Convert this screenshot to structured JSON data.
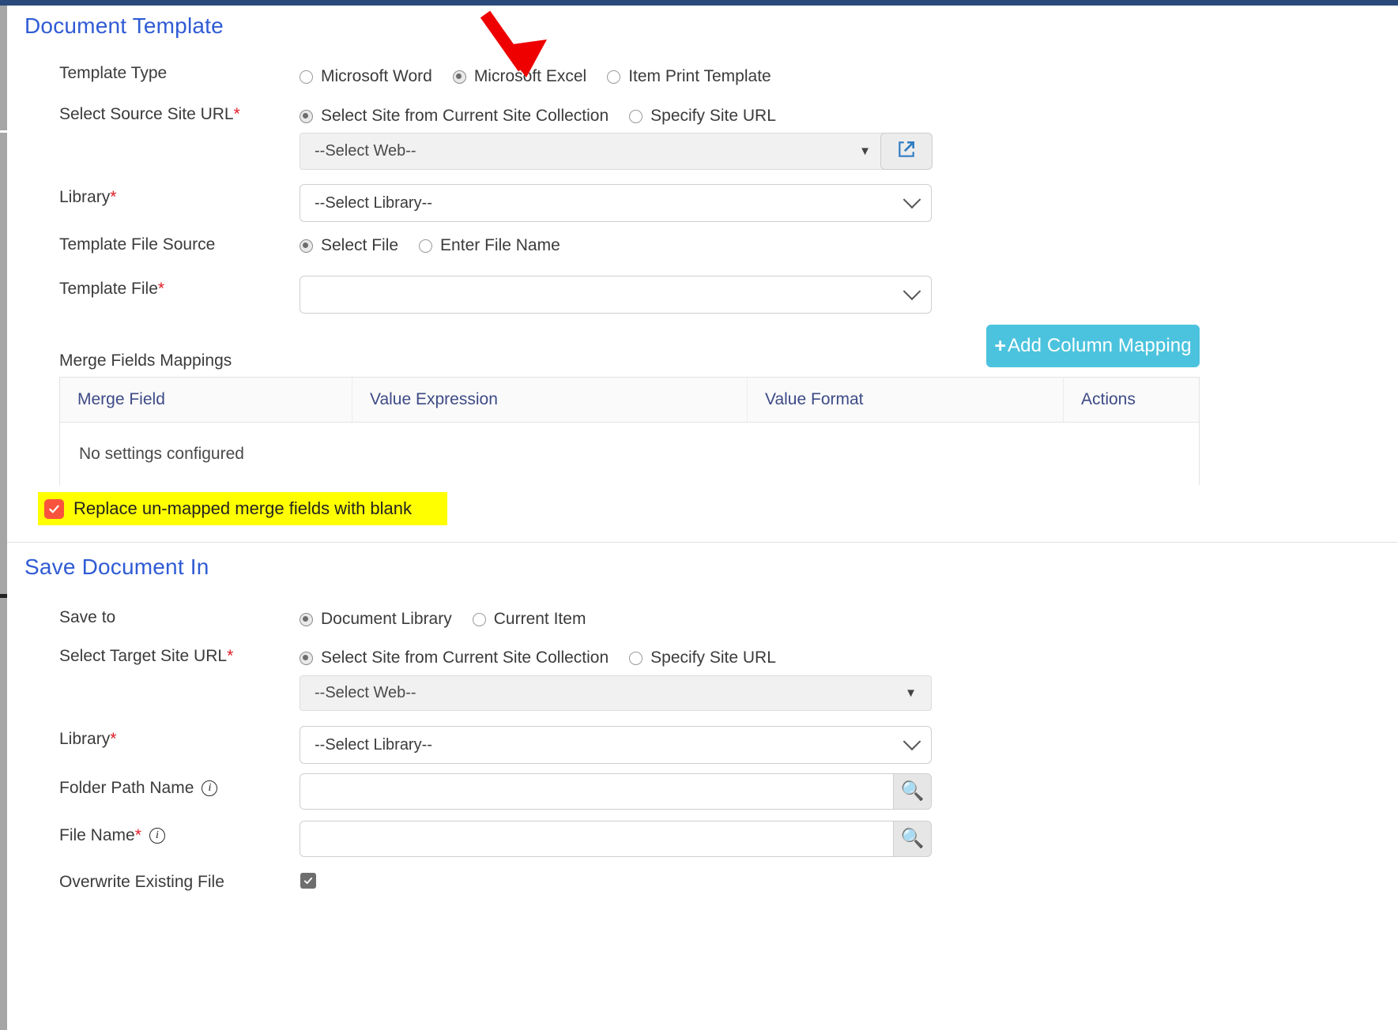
{
  "document_template": {
    "heading": "Document Template",
    "template_type": {
      "label": "Template Type",
      "options": [
        "Microsoft Word",
        "Microsoft Excel",
        "Item Print Template"
      ],
      "selected": "Microsoft Excel"
    },
    "source_site_url": {
      "label": "Select Source Site URL",
      "required_mark": "*",
      "options": [
        "Select Site from Current Site Collection",
        "Specify Site URL"
      ],
      "selected": "Select Site from Current Site Collection"
    },
    "web_select": {
      "value": "--Select Web--",
      "caret": "▼",
      "open_button_icon": "external-link-icon"
    },
    "library": {
      "label": "Library",
      "required_mark": "*",
      "value": "--Select Library--"
    },
    "template_file_source": {
      "label": "Template File Source",
      "options": [
        "Select File",
        "Enter File Name"
      ],
      "selected": "Select File"
    },
    "template_file": {
      "label": "Template File",
      "required_mark": "*",
      "value": ""
    },
    "merge_fields": {
      "label": "Merge Fields Mappings",
      "add_button_plus": "+",
      "add_button_label": "Add Column Mapping",
      "columns": [
        "Merge Field",
        "Value Expression",
        "Value Format",
        "Actions"
      ],
      "empty_message": "No settings configured"
    },
    "replace_unmapped": {
      "label": "Replace un-mapped merge fields with blank",
      "checked": true,
      "highlight_color": "#ffff00",
      "checkbox_color": "#f9533e"
    }
  },
  "save_document_in": {
    "heading": "Save Document In",
    "save_to": {
      "label": "Save to",
      "options": [
        "Document Library",
        "Current Item"
      ],
      "selected": "Document Library"
    },
    "target_site_url": {
      "label": "Select Target Site URL",
      "required_mark": "*",
      "options": [
        "Select Site from Current Site Collection",
        "Specify Site URL"
      ],
      "selected": "Select Site from Current Site Collection"
    },
    "web_select": {
      "value": "--Select Web--",
      "caret": "▼"
    },
    "library": {
      "label": "Library",
      "required_mark": "*",
      "value": "--Select Library--"
    },
    "folder_path_name": {
      "label": "Folder Path Name",
      "info_icon": "info-icon",
      "value": "",
      "browse_icon": "binoculars-icon"
    },
    "file_name": {
      "label": "File Name",
      "required_mark": "*",
      "info_icon": "info-icon",
      "value": "",
      "browse_icon": "binoculars-icon"
    },
    "overwrite_existing_file": {
      "label": "Overwrite Existing File",
      "checked": true
    }
  },
  "annotation": {
    "arrow_color": "#ee0000",
    "points_to": "Microsoft Excel"
  },
  "theme": {
    "heading_color": "#2f5bd4",
    "accent_button": "#4cc3de",
    "required_color": "#e01b24",
    "table_header_text": "#3d4a86"
  }
}
